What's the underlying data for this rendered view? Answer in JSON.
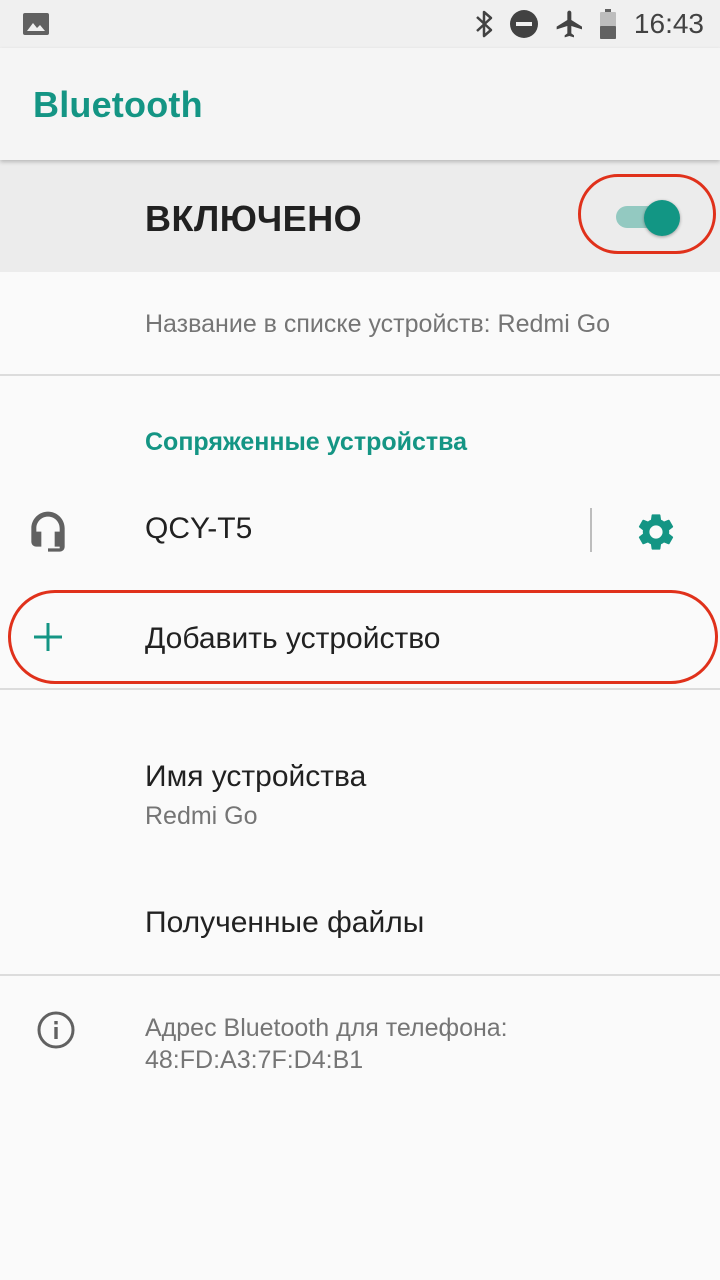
{
  "status_bar": {
    "time": "16:43",
    "icons": [
      "image-icon",
      "bluetooth-icon",
      "do-not-disturb-icon",
      "airplane-icon",
      "battery-icon"
    ]
  },
  "app_bar": {
    "title": "Bluetooth"
  },
  "master_switch": {
    "label": "ВКЛЮЧЕНО",
    "checked": true
  },
  "device_visibility": {
    "summary": "Название в списке устройств: Redmi Go"
  },
  "paired_devices": {
    "header": "Сопряженные устройства",
    "items": [
      {
        "name": "QCY-T5",
        "icon": "headset-icon",
        "settings_icon": "gear-icon"
      }
    ]
  },
  "add_device": {
    "label": "Добавить устройство",
    "icon": "plus-icon"
  },
  "device_name": {
    "title": "Имя устройства",
    "value": "Redmi Go"
  },
  "received_files": {
    "title": "Полученные файлы"
  },
  "footer": {
    "line1": "Адрес Bluetooth для телефона:",
    "line2": "48:FD:A3:7F:D4:B1",
    "icon": "info-icon"
  },
  "colors": {
    "accent": "#149584",
    "annotation": "#e0311b",
    "switch_track": "#93c9c1"
  }
}
